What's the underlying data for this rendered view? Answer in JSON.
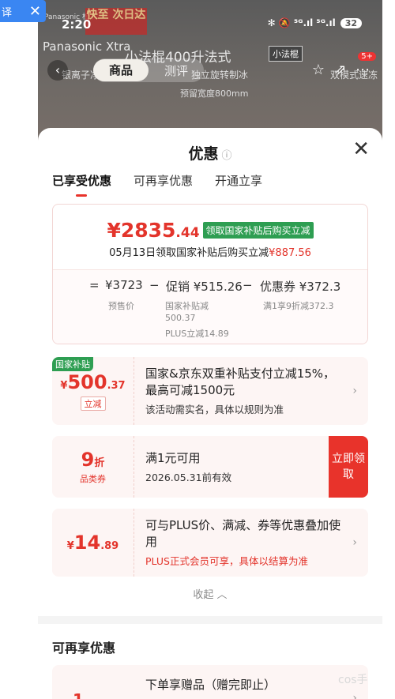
{
  "translate_chip": {
    "label": "译",
    "close": "✕"
  },
  "background_page": {
    "status": {
      "time": "2:20",
      "signal": "✻ 🔕 ⁵ᴳ.ıl ⁵ᴳ.ıl",
      "battery": "32"
    },
    "brand_top": "Panasonic 松下",
    "banner": "快至 次日达",
    "brand": "Panasonic Xtra",
    "title_strip": "小法棍400升法式",
    "tag": "小法棍",
    "tabs": [
      "商品",
      "测评"
    ],
    "features": [
      "银离子净味",
      "独立旋转制冰",
      "双模式速冻"
    ],
    "width_note": "预留宽度800mm",
    "badge": "5+"
  },
  "sheet": {
    "title": "优惠",
    "info_icon": "ⓘ",
    "close_icon": "✕",
    "tabs": [
      "已享受优惠",
      "可再享优惠",
      "开通立享"
    ],
    "price_card": {
      "price_main": "¥2835",
      "price_dec": ".44",
      "price_tag": "领取国家补贴后购买立减",
      "sub_text": "05月13日领取国家补贴后购买立减",
      "sub_amount": "¥887.56",
      "calc": {
        "eq": "=",
        "presale": "¥3723",
        "minus1": "−",
        "promo": "促销 ¥515.26",
        "minus2": "−",
        "coupon": "优惠券 ¥372.3",
        "presale_label": "预售价",
        "promo_detail": [
          "国家补贴减",
          "500.37",
          "PLUS立减14.89"
        ],
        "coupon_detail": "满1享9折减372.3"
      }
    },
    "promos": [
      {
        "corner": "国家补贴",
        "amount_yen": "¥",
        "amount_int": "500",
        "amount_dec": ".37",
        "badge": "立减",
        "title": "国家&京东双重补贴支付立减15%，最高可减1500元",
        "desc": "该活动需实名，具体以规则为准"
      },
      {
        "amount_int": "9",
        "amount_unit": "折",
        "badge": "品类券",
        "title": "满1元可用",
        "desc": "2026.05.31前有效",
        "button": "立即领取"
      },
      {
        "amount_yen": "¥",
        "amount_int": "14",
        "amount_dec": ".89",
        "title": "可与PLUS价、满减、券等优惠叠加使用",
        "desc": "PLUS正式会员可享，具体以结算为准"
      }
    ],
    "collapse": "收起 ︿",
    "section_title": "可再享优惠",
    "next_card": {
      "title": "下单享赠品（赠完即止）",
      "amount": "1"
    },
    "chevron": "›"
  },
  "watermark": "cos手",
  "colors": {
    "accent": "#e3342b",
    "green": "#2e9e52",
    "card_bg": "#fdf5f4"
  }
}
